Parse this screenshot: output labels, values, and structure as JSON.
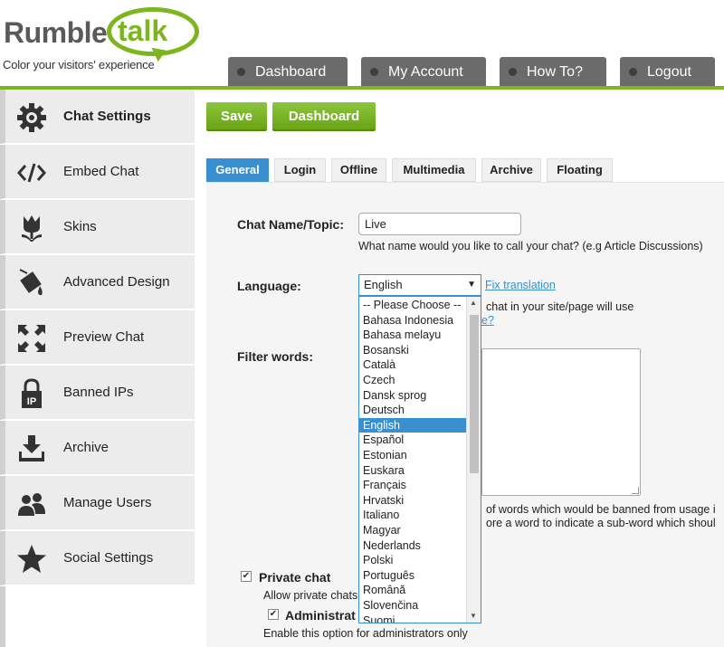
{
  "header": {
    "logo_word1": "Rumble",
    "logo_word2": "talk",
    "tagline": "Color your visitors' experience",
    "tabs": [
      {
        "label": "Dashboard"
      },
      {
        "label": "My Account"
      },
      {
        "label": "How To?"
      },
      {
        "label": "Logout"
      }
    ]
  },
  "sidebar": {
    "items": [
      {
        "label": "Chat Settings",
        "icon": "gear-icon"
      },
      {
        "label": "Embed Chat",
        "icon": "code-icon"
      },
      {
        "label": "Skins",
        "icon": "tulip-icon"
      },
      {
        "label": "Advanced Design",
        "icon": "paint-bucket-icon"
      },
      {
        "label": "Preview Chat",
        "icon": "expand-arrows-icon"
      },
      {
        "label": "Banned IPs",
        "icon": "ip-lock-icon"
      },
      {
        "label": "Archive",
        "icon": "download-icon"
      },
      {
        "label": "Manage Users",
        "icon": "users-icon"
      },
      {
        "label": "Social Settings",
        "icon": "star-icon"
      }
    ]
  },
  "actions": {
    "save": "Save",
    "dashboard": "Dashboard"
  },
  "tabs": [
    "General",
    "Login",
    "Offline",
    "Multimedia",
    "Archive",
    "Floating"
  ],
  "form": {
    "chat_name_label": "Chat Name/Topic:",
    "chat_name_value": "Live",
    "chat_name_hint": "What name would you like to call your chat? (e.g Article Discussions)",
    "language_label": "Language:",
    "language_value": "English",
    "fix_translation": "Fix translation",
    "language_hint_partial": "chat in your site/page will use",
    "language_link_partial": "e?",
    "filter_label": "Filter words:",
    "filter_hint1": "of words which would be banned from usage i",
    "filter_hint2": "ore a word to indicate a sub-word which shoul",
    "private_chat_label": "Private chat",
    "private_chat_hint": "Allow private chats",
    "admin_label": "Administrat",
    "admin_hint": "Enable this option for administrators only"
  },
  "language_options": [
    "-- Please Choose --",
    "Bahasa Indonesia",
    "Bahasa melayu",
    "Bosanski",
    "Català",
    "Czech",
    "Dansk sprog",
    "Deutsch",
    "English",
    "Español",
    "Estonian",
    "Euskara",
    "Français",
    "Hrvatski",
    "Italiano",
    "Magyar",
    "Nederlands",
    "Polski",
    "Português",
    "Română",
    "Slovenčina",
    "Suomi"
  ],
  "colors": {
    "brand_green": "#7cb51e",
    "active_blue": "#3a8fd0",
    "tab_gray": "#6b6b6b"
  }
}
